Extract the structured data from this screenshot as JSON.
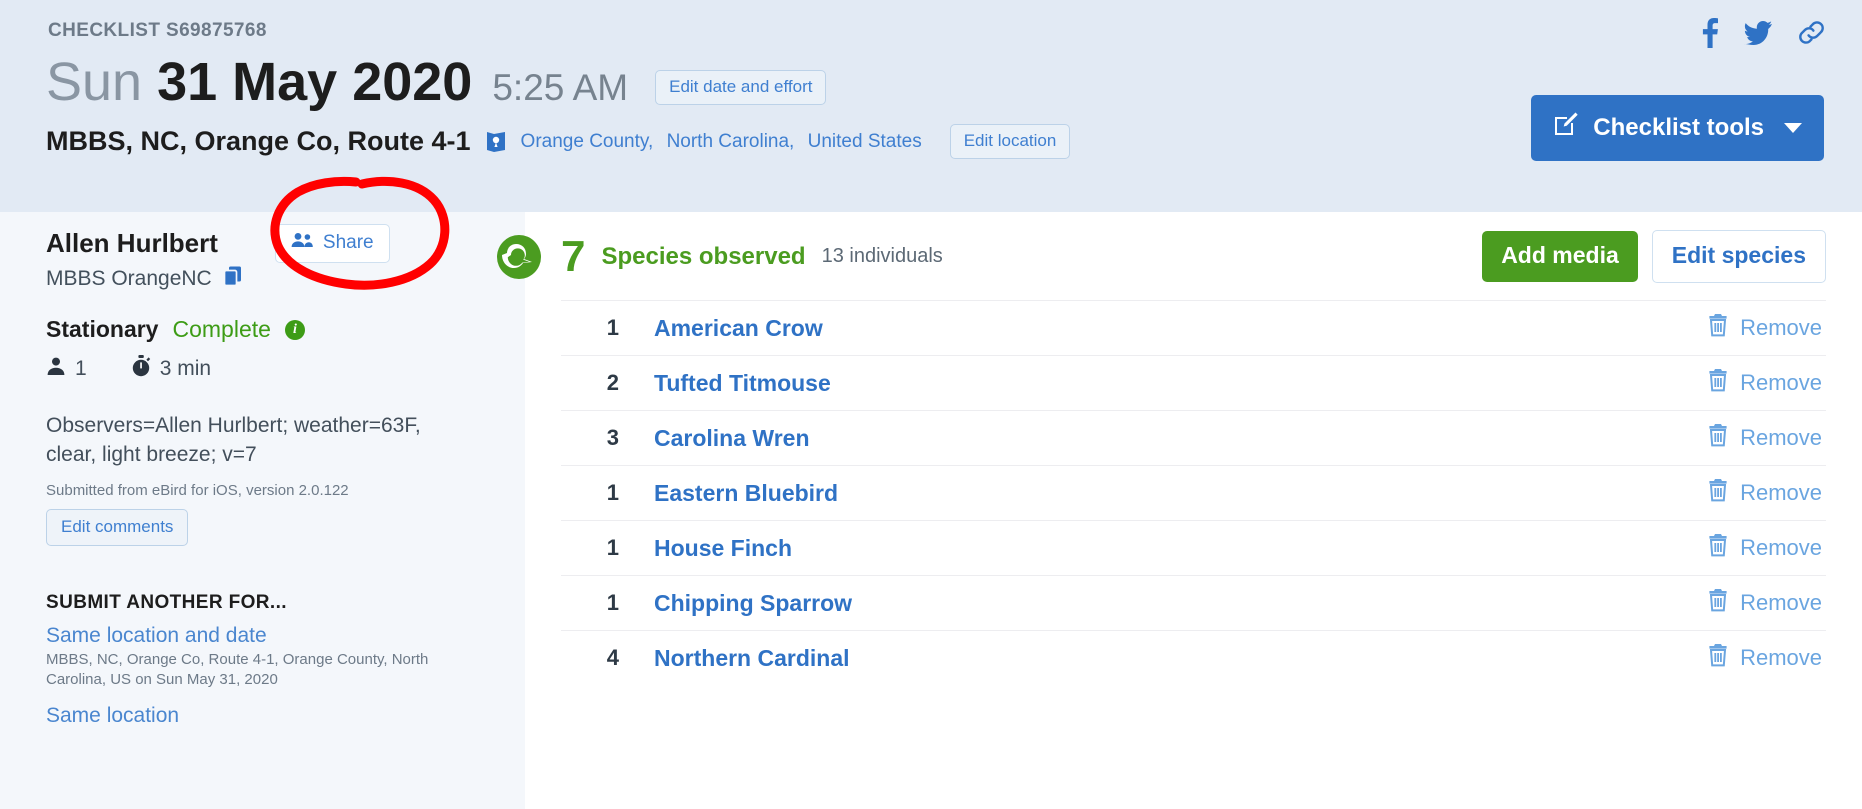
{
  "header": {
    "checklist_id": "CHECKLIST S69875768",
    "date_weekday": "Sun",
    "date_main": "31 May 2020",
    "time": "5:25 AM",
    "edit_date_label": "Edit date and effort",
    "location_name": "MBBS, NC, Orange Co, Route 4-1",
    "location_breadcrumb": [
      "Orange County,",
      "North Carolina,",
      "United States"
    ],
    "edit_location_label": "Edit location",
    "tools_label": "Checklist tools",
    "social": [
      {
        "icon": "facebook-icon",
        "label": "f"
      },
      {
        "icon": "twitter-icon",
        "label": ""
      },
      {
        "icon": "link-icon",
        "label": ""
      }
    ]
  },
  "sidebar": {
    "observer_name": "Allen Hurlbert",
    "share_label": "Share",
    "protocol_name": "MBBS OrangeNC",
    "status_type": "Stationary",
    "status_complete": "Complete",
    "info_glyph": "i",
    "party_size": "1",
    "duration": "3 min",
    "comments": "Observers=Allen Hurlbert; weather=63F, clear, light breeze; v=7",
    "submitted_from": "Submitted from eBird for iOS, version 2.0.122",
    "edit_comments_label": "Edit comments",
    "submit_another_title": "SUBMIT ANOTHER FOR...",
    "same_location_date_label": "Same location and date",
    "same_location_date_sub": "MBBS, NC, Orange Co, Route 4-1, Orange County, North Carolina, US on Sun May 31, 2020",
    "same_location_label": "Same location"
  },
  "main": {
    "species_count": "7",
    "species_label": "Species observed",
    "individuals": "13 individuals",
    "add_media_label": "Add media",
    "edit_species_label": "Edit species",
    "remove_label": "Remove",
    "species": [
      {
        "count": "1",
        "name": "American Crow"
      },
      {
        "count": "2",
        "name": "Tufted Titmouse"
      },
      {
        "count": "3",
        "name": "Carolina Wren"
      },
      {
        "count": "1",
        "name": "Eastern Bluebird"
      },
      {
        "count": "1",
        "name": "House Finch"
      },
      {
        "count": "1",
        "name": "Chipping Sparrow"
      },
      {
        "count": "4",
        "name": "Northern Cardinal"
      }
    ]
  },
  "colors": {
    "brand_blue": "#2f72c5",
    "link_blue": "#3f7fd0",
    "green": "#4b9c20",
    "header_bg": "#e2eaf4",
    "sidebar_bg": "#f4f7fb",
    "annotation_red": "#ff0000"
  }
}
